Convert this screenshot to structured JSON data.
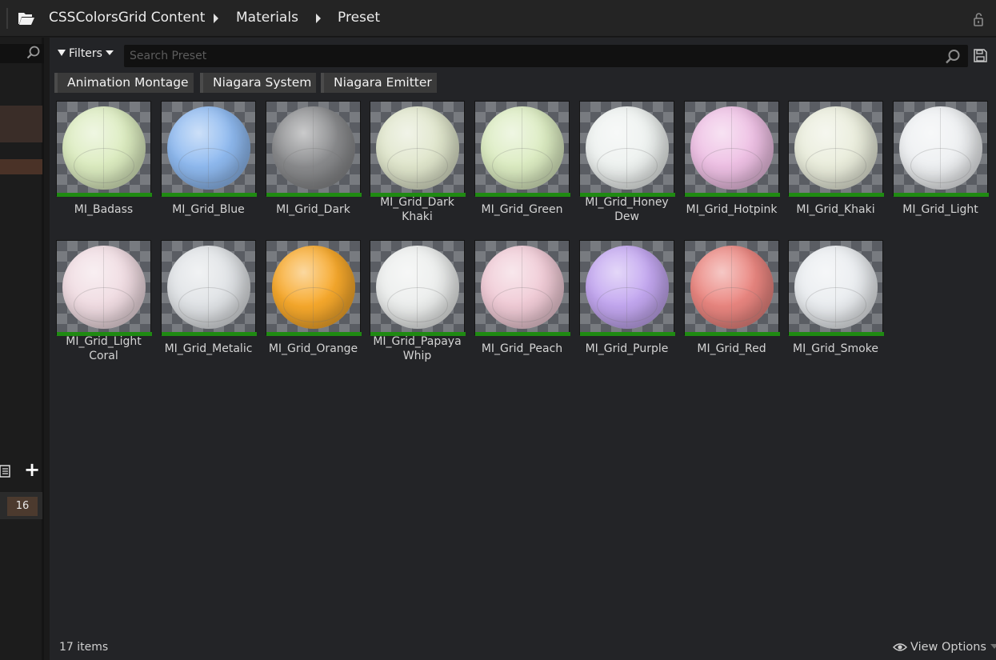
{
  "breadcrumb": {
    "items": [
      {
        "label": "CSSColorsGrid Content"
      },
      {
        "label": "Materials"
      },
      {
        "label": "Preset"
      }
    ]
  },
  "left_panel": {
    "count_badge": "16"
  },
  "toolbar": {
    "filters_label": "Filters",
    "search_placeholder": "Search Preset",
    "search_value": ""
  },
  "filter_chips": [
    {
      "label": "Animation Montage"
    },
    {
      "label": "Niagara System"
    },
    {
      "label": "Niagara Emitter"
    }
  ],
  "assets": [
    {
      "line1": "MI_Badass",
      "line2": "",
      "color": "#dcecc0"
    },
    {
      "line1": "MI_Grid_Blue",
      "line2": "",
      "color": "#8fbaf0"
    },
    {
      "line1": "MI_Grid_Dark",
      "line2": "",
      "color": "#8a8b8d"
    },
    {
      "line1": "MI_Grid_Dark",
      "line2": "Khaki",
      "color": "#e0e6cc"
    },
    {
      "line1": "MI_Grid_Green",
      "line2": "",
      "color": "#dcecc2"
    },
    {
      "line1": "MI_Grid_Honey",
      "line2": "Dew",
      "color": "#eef2f0"
    },
    {
      "line1": "MI_Grid_Hotpink",
      "line2": "",
      "color": "#eec0e4"
    },
    {
      "line1": "MI_Grid_Khaki",
      "line2": "",
      "color": "#eaeddc"
    },
    {
      "line1": "MI_Grid_Light",
      "line2": "",
      "color": "#eef0f2"
    },
    {
      "line1": "MI_Grid_Light",
      "line2": "Coral",
      "color": "#f0dce2"
    },
    {
      "line1": "MI_Grid_Metalic",
      "line2": "",
      "color": "#e0e3e6"
    },
    {
      "line1": "MI_Grid_Orange",
      "line2": "",
      "color": "#f7a92c"
    },
    {
      "line1": "MI_Grid_Papaya",
      "line2": "Whip",
      "color": "#eceeed"
    },
    {
      "line1": "MI_Grid_Peach",
      "line2": "",
      "color": "#f0cbd6"
    },
    {
      "line1": "MI_Grid_Purple",
      "line2": "",
      "color": "#c3a7f0"
    },
    {
      "line1": "MI_Grid_Red",
      "line2": "",
      "color": "#ea8680"
    },
    {
      "line1": "MI_Grid_Smoke",
      "line2": "",
      "color": "#eaedf0"
    }
  ],
  "status": {
    "item_count": "17 items",
    "view_options_label": "View Options"
  }
}
